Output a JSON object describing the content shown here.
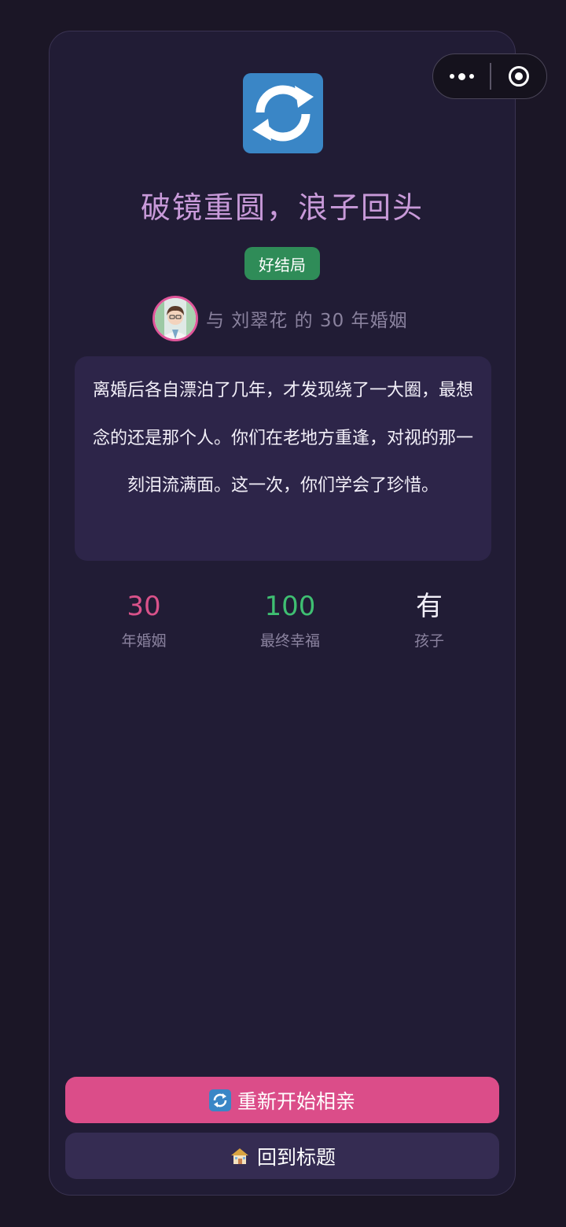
{
  "ending": {
    "title": "破镜重圆，浪子回头",
    "badge": "好结局",
    "partner_text": "与 刘翠花 的 30 年婚姻",
    "story": "离婚后各自漂泊了几年，才发现绕了一大圈，最想念的还是那个人。你们在老地方重逢，对视的那一刻泪流满面。这一次，你们学会了珍惜。",
    "icon": "refresh-arrows-icon"
  },
  "stats": [
    {
      "value": "30",
      "label": "年婚姻",
      "color": "#d9528a"
    },
    {
      "value": "100",
      "label": "最终幸福",
      "color": "#3fbf72"
    },
    {
      "value": "有",
      "label": "孩子",
      "color": "#f2eff8"
    }
  ],
  "buttons": {
    "restart_label": "重新开始相亲",
    "restart_icon": "refresh-icon",
    "home_label": "回到标题",
    "home_icon": "house-icon"
  },
  "colors": {
    "background": "#1b1626",
    "card": "#211c35",
    "title": "#c89ad9",
    "badge": "#2f8c58",
    "restart_button": "#db4d89",
    "home_button": "#352c52"
  }
}
